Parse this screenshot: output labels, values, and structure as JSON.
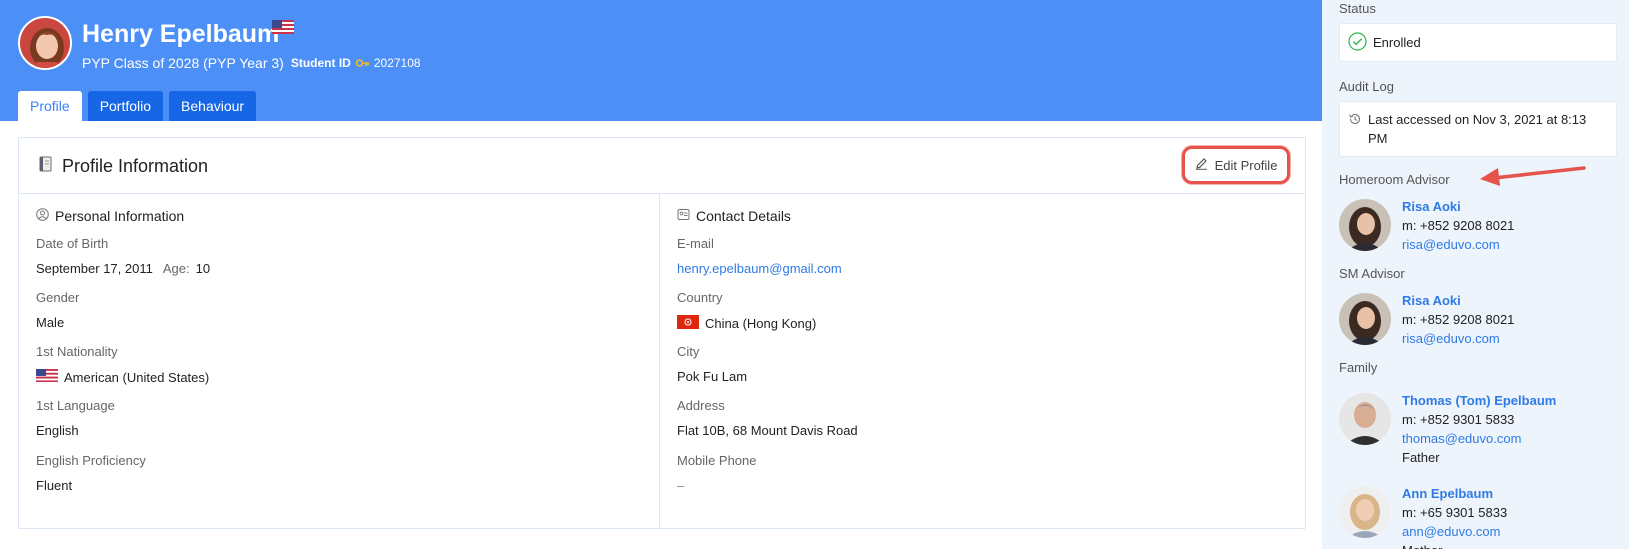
{
  "student": {
    "name": "Henry Epelbaum",
    "class_line": "PYP Class of 2028 (PYP Year 3)",
    "student_id_label": "Student ID",
    "student_id": "2027108"
  },
  "tabs": [
    {
      "label": "Profile",
      "active": true
    },
    {
      "label": "Portfolio",
      "active": false
    },
    {
      "label": "Behaviour",
      "active": false
    }
  ],
  "profile_card": {
    "title": "Profile Information",
    "edit_label": "Edit Profile"
  },
  "personal": {
    "title": "Personal Information",
    "dob_label": "Date of Birth",
    "dob_value": "September 17, 2011",
    "age_label": "Age:",
    "age_value": "10",
    "gender_label": "Gender",
    "gender_value": "Male",
    "nationality_label": "1st Nationality",
    "nationality_value": "American (United States)",
    "language_label": "1st Language",
    "language_value": "English",
    "proficiency_label": "English Proficiency",
    "proficiency_value": "Fluent"
  },
  "contact": {
    "title": "Contact Details",
    "email_label": "E-mail",
    "email_value": "henry.epelbaum@gmail.com",
    "country_label": "Country",
    "country_value": "China (Hong Kong)",
    "city_label": "City",
    "city_value": "Pok Fu Lam",
    "address_label": "Address",
    "address_value": "Flat 10B, 68 Mount Davis Road",
    "mobile_label": "Mobile Phone",
    "mobile_value": "–"
  },
  "sidebar": {
    "status_label": "Status",
    "status_value": "Enrolled",
    "audit_label": "Audit Log",
    "audit_line1": "Last accessed on Nov 3, 2021 at 8:13",
    "audit_line2": "PM",
    "homeroom_label": "Homeroom Advisor",
    "homeroom": {
      "name": "Risa Aoki",
      "phone": "m: +852 9208 8021",
      "email": "risa@eduvo.com"
    },
    "sm_label": "SM Advisor",
    "sm": {
      "name": "Risa Aoki",
      "phone": "m: +852 9208 8021",
      "email": "risa@eduvo.com"
    },
    "family_label": "Family",
    "family": [
      {
        "name": "Thomas (Tom) Epelbaum",
        "phone": "m: +852 9301 5833",
        "email": "thomas@eduvo.com",
        "relation": "Father"
      },
      {
        "name": "Ann Epelbaum",
        "phone": "m: +65 9301 5833",
        "email": "ann@eduvo.com",
        "relation": "Mother"
      }
    ]
  },
  "colors": {
    "header_blue": "#4b8ff7",
    "tab_blue": "#1666e6",
    "link_blue": "#2f7be5",
    "highlight_red": "#e5534b",
    "enrolled_green": "#2bb34a"
  }
}
